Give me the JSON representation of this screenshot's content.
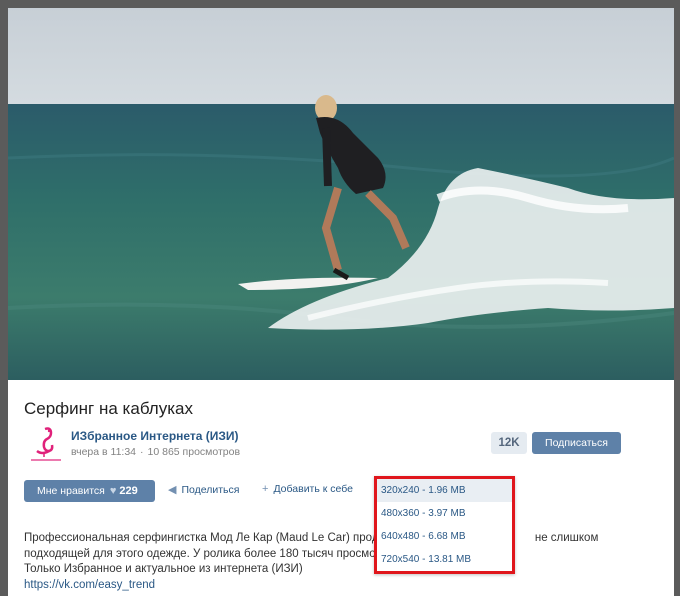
{
  "video": {
    "title": "Серфинг на каблуках"
  },
  "channel": {
    "name": "ИЗбранное Интернета (ИЗИ)",
    "posted": "вчера в 11:34",
    "views": "10 865 просмотров",
    "subscribers": "12K",
    "subscribe_label": "Подписаться",
    "accent": "#5e81a8"
  },
  "actions": {
    "like_label": "Мне нравится",
    "like_count": "229",
    "share_label": "Поделиться",
    "add_label": "Добавить к себе"
  },
  "download_menu": {
    "options": [
      "320x240 - 1.96 MB",
      "480x360 - 3.97 MB",
      "640x480 - 6.68 MB",
      "720x540 - 13.81 MB"
    ],
    "highlight_color": "#e0161c"
  },
  "description": {
    "line1_start": "Профессиональная серфингистка Мод Ле Кар (Maud Le Car) продем",
    "line1_end": "не слишком",
    "line2": "подходящей для этого одежде. У ролика более 180 тысяч просмотр",
    "line3": "Только Избранное и актуальное из интернета (ИЗИ)",
    "link": "https://vk.com/easy_trend"
  }
}
